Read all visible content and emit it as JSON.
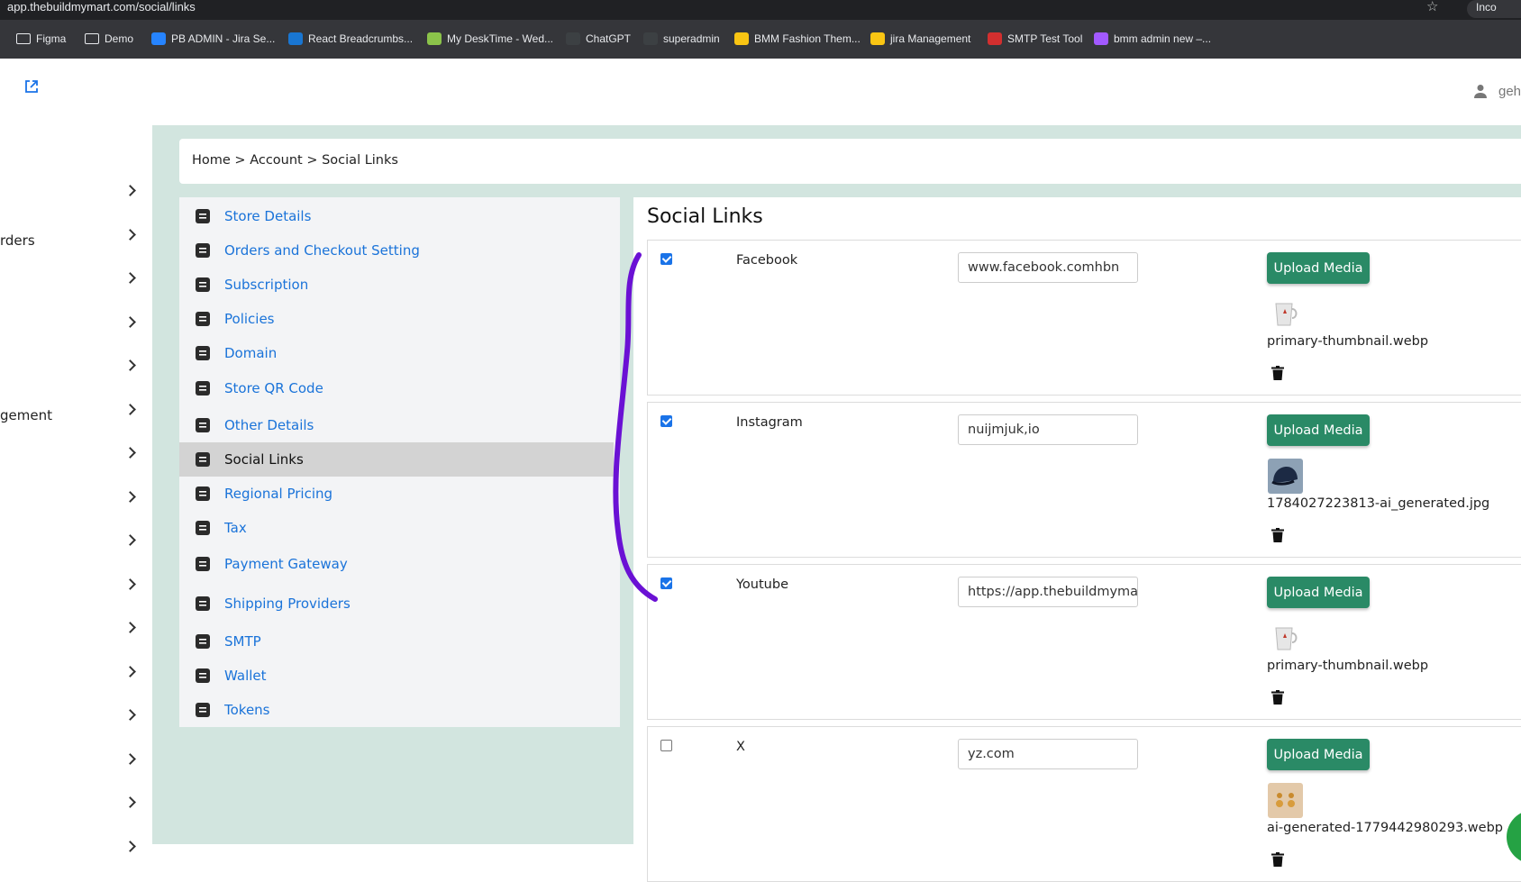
{
  "browser": {
    "url": "app.thebuildmymart.com/social/links",
    "profile_label": "Inco",
    "bookmarks": [
      {
        "label": "Figma",
        "icon": "folder-icon"
      },
      {
        "label": "Demo",
        "icon": "folder-icon"
      },
      {
        "label": "PB ADMIN  - Jira Se...",
        "icon": "jira-icon"
      },
      {
        "label": "React Breadcrumbs...",
        "icon": "mui-icon"
      },
      {
        "label": "My DeskTime - Wed...",
        "icon": "desktime-icon"
      },
      {
        "label": "ChatGPT",
        "icon": "chatgpt-icon"
      },
      {
        "label": "superadmin",
        "icon": "globe-icon"
      },
      {
        "label": "BMM Fashion Them...",
        "icon": "bolt-icon"
      },
      {
        "label": "jira Management",
        "icon": "bolt-icon"
      },
      {
        "label": "SMTP Test Tool",
        "icon": "smtp-icon"
      },
      {
        "label": "bmm admin new –...",
        "icon": "figma-icon"
      }
    ]
  },
  "header": {
    "user_name": "geh"
  },
  "rail": {
    "labels": [
      "",
      "rders",
      "",
      "",
      "",
      "gement",
      "",
      "",
      "",
      "",
      "",
      "",
      "",
      "",
      "",
      ""
    ]
  },
  "breadcrumb": "Home > Account > Social Links",
  "settings_nav": [
    {
      "label": "Store Details",
      "icon": "store-details-icon",
      "active": false
    },
    {
      "label": "Orders and Checkout Setting",
      "icon": "checkout-icon",
      "active": false
    },
    {
      "label": "Subscription",
      "icon": "subscription-icon",
      "active": false
    },
    {
      "label": "Policies",
      "icon": "policies-icon",
      "active": false
    },
    {
      "label": "Domain",
      "icon": "domain-icon",
      "active": false
    },
    {
      "label": "Store QR Code",
      "icon": "qr-code-icon",
      "active": false
    },
    {
      "label": "Other Details",
      "icon": "list-icon",
      "active": false
    },
    {
      "label": "Social Links",
      "icon": "link-icon",
      "active": true
    },
    {
      "label": "Regional Pricing",
      "icon": "globe-pricing-icon",
      "active": false
    },
    {
      "label": "Tax",
      "icon": "tax-icon",
      "active": false
    },
    {
      "label": "Payment Gateway",
      "icon": "payment-icon",
      "active": false
    },
    {
      "label": "Shipping Providers",
      "icon": "truck-icon",
      "active": false
    },
    {
      "label": "SMTP",
      "icon": "mail-icon",
      "active": false
    },
    {
      "label": "Wallet",
      "icon": "wallet-icon",
      "active": false
    },
    {
      "label": "Tokens",
      "icon": "token-icon",
      "active": false
    }
  ],
  "content": {
    "title": "Social Links",
    "upload_label": "Upload Media",
    "links": [
      {
        "platform": "Facebook",
        "checked": true,
        "url": "www.facebook.comhbn",
        "file": "primary-thumbnail.webp",
        "thumb": "mug"
      },
      {
        "platform": "Instagram",
        "checked": true,
        "url": "nuijmjuk,io",
        "file": "1784027223813-ai_generated.jpg",
        "thumb": "cap"
      },
      {
        "platform": "Youtube",
        "checked": true,
        "url": "https://app.thebuildmymart",
        "file": "primary-thumbnail.webp",
        "thumb": "mug"
      },
      {
        "platform": "X",
        "checked": false,
        "url": "yz.com",
        "file": "ai-generated-1779442980293.webp",
        "thumb": "earrings"
      }
    ]
  },
  "colors": {
    "accent": "#1a73d9",
    "button": "#2a8a66",
    "main_bg": "#d2e5df",
    "annotation": "#6a11d4"
  }
}
